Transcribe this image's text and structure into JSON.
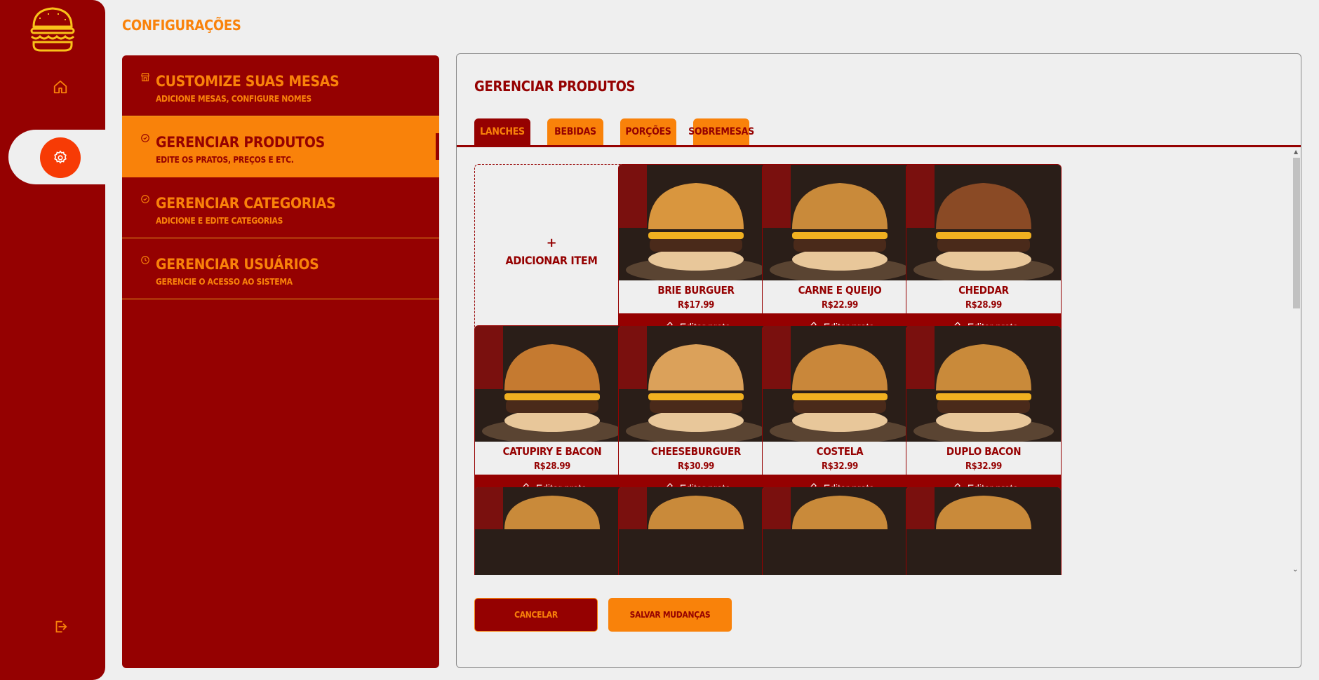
{
  "colors": {
    "primary": "#950101",
    "accent": "#f9820a",
    "active_circle": "#f73b05",
    "background": "#efefef"
  },
  "rail": {
    "logo_icon": "burger-logo",
    "home_icon": "home-icon",
    "settings_icon": "gear-icon",
    "logout_icon": "logout-icon"
  },
  "page": {
    "title": "CONFIGURAÇÕES"
  },
  "menu": {
    "items": [
      {
        "title": "CUSTOMIZE SUAS MESAS",
        "subtitle": "ADICIONE MESAS, CONFIGURE NOMES",
        "icon": "store-icon",
        "active": false
      },
      {
        "title": "GERENCIAR PRODUTOS",
        "subtitle": "EDITE OS PRATOS, PREÇOS E ETC.",
        "icon": "badge-check-icon",
        "active": true
      },
      {
        "title": "GERENCIAR CATEGORIAS",
        "subtitle": "ADICIONE E EDITE CATEGORIAS",
        "icon": "badge-check-icon",
        "active": false
      },
      {
        "title": "GERENCIAR USUÁRIOS",
        "subtitle": "GERENCIE O ACESSO AO SISTEMA",
        "icon": "clock-icon",
        "active": false
      }
    ]
  },
  "main": {
    "title": "GERENCIAR PRODUTOS",
    "tabs": [
      {
        "label": "LANCHES",
        "active": true
      },
      {
        "label": "BEBIDAS",
        "active": false
      },
      {
        "label": "PORÇÕES",
        "active": false
      },
      {
        "label": "SOBREMESAS",
        "active": false
      }
    ],
    "add_item": {
      "plus": "+",
      "label": "ADICIONAR ITEM"
    },
    "edit_label": "Editar prato",
    "products": [
      {
        "name": "BRIE BURGUER",
        "price": "R$17.99"
      },
      {
        "name": "CARNE E QUEIJO",
        "price": "R$22.99"
      },
      {
        "name": "CHEDDAR",
        "price": "R$28.99"
      },
      {
        "name": "CATUPIRY E BACON",
        "price": "R$28.99"
      },
      {
        "name": "CHEESEBURGUER",
        "price": "R$30.99"
      },
      {
        "name": "COSTELA",
        "price": "R$32.99"
      },
      {
        "name": "DUPLO BACON",
        "price": "R$32.99"
      }
    ],
    "cancel_label": "CANCELAR",
    "save_label": "SALVAR MUDANÇAS"
  }
}
